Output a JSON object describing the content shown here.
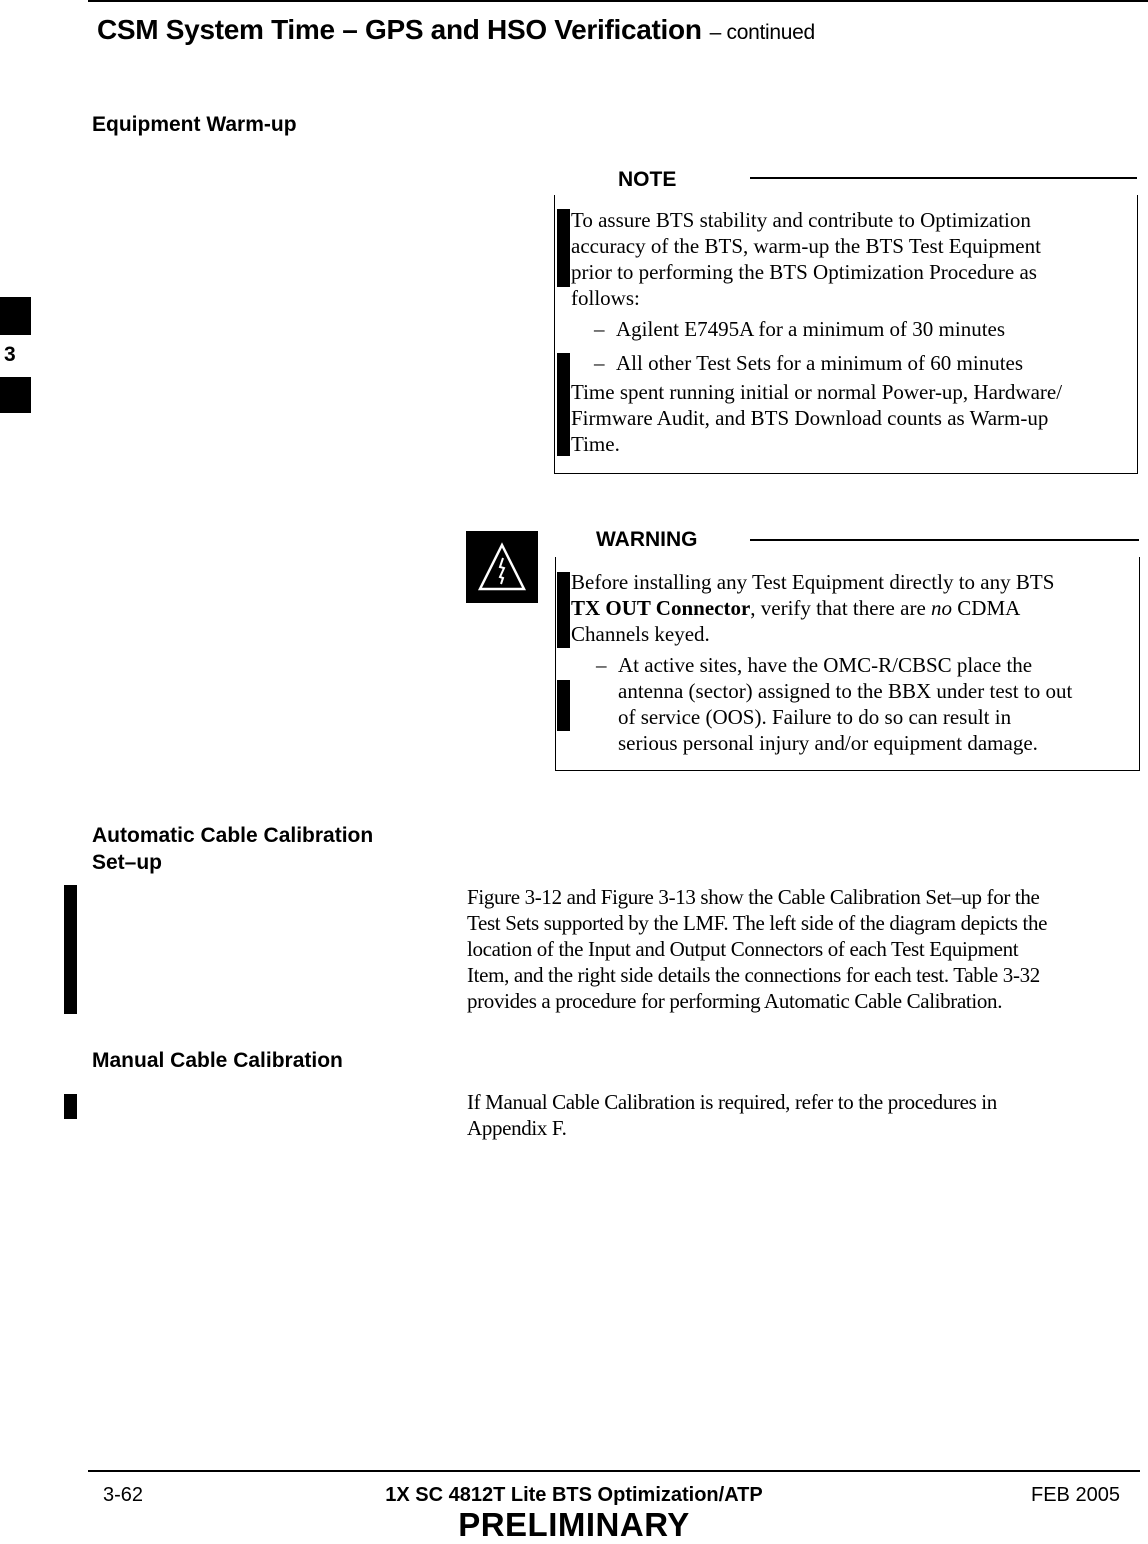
{
  "header": {
    "title": "CSM System Time – GPS and HSO Verification",
    "continued": "– continued"
  },
  "side_tab": {
    "chapter": "3"
  },
  "sections": {
    "warmup": {
      "heading": "Equipment Warm-up",
      "note": {
        "label": "NOTE",
        "lines": [
          "To assure BTS stability and contribute to Optimization",
          "accuracy of the BTS, warm-up the BTS Test Equipment",
          "prior to performing the BTS Optimization Procedure as",
          "follows:"
        ],
        "bullets": [
          "Agilent E7495A for a minimum of 30 minutes",
          "All other Test Sets for a minimum of 60 minutes"
        ],
        "tail_lines": [
          "Time spent running initial or normal Power-up, Hardware/",
          "Firmware Audit, and BTS Download counts as Warm-up",
          "Time."
        ]
      },
      "warning": {
        "label": "WARNING",
        "icon": "electrical-hazard-warning-icon",
        "line1": "Before installing any Test Equipment directly to any BTS",
        "line2_bold": "TX OUT Connector",
        "line2_mid": ", verify that there are ",
        "line2_italic": "no",
        "line2_end": " CDMA",
        "line3": "Channels keyed.",
        "bullet_lines": [
          "At active sites, have the OMC-R/CBSC place the",
          "antenna (sector) assigned to the BBX under test to out",
          "of service (OOS). Failure to do so can result in",
          "serious personal injury and/or equipment damage."
        ]
      }
    },
    "auto_cal": {
      "heading_line1": "Automatic Cable Calibration",
      "heading_line2": "Set–up",
      "lines": [
        "Figure 3-12 and Figure 3-13 show the Cable Calibration Set–up for the",
        "Test Sets supported by the LMF. The left side of the diagram depicts the",
        "location of the Input and Output Connectors of each Test Equipment",
        "Item, and the right side details the connections for each test. Table 3-32",
        "provides a procedure for performing Automatic Cable Calibration."
      ]
    },
    "manual_cal": {
      "heading": "Manual Cable Calibration",
      "lines": [
        "If Manual Cable Calibration is required, refer to the procedures in",
        "Appendix F."
      ]
    }
  },
  "footer": {
    "page_number": "3-62",
    "doc_title": "1X SC 4812T Lite BTS Optimization/ATP",
    "date": "FEB 2005",
    "status": "PRELIMINARY"
  }
}
